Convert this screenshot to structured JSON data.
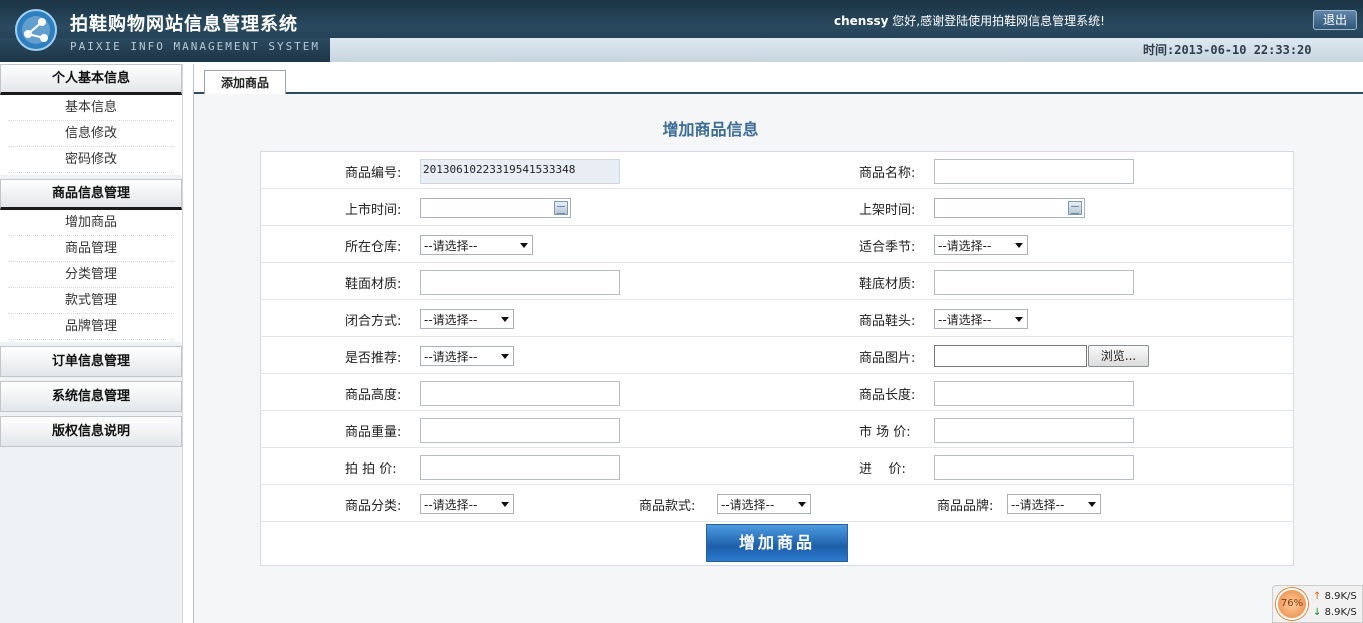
{
  "header": {
    "title": "拍鞋购物网站信息管理系统",
    "subtitle": "PAIXIE INFO MANAGEMENT SYSTEM",
    "welcome_user": "chenssy",
    "welcome_text": " 您好,感谢登陆使用拍鞋网信息管理系统!",
    "logout_label": "退出",
    "time_text": "时间:2013-06-10 22:33:20"
  },
  "sidebar": {
    "sections": [
      {
        "label": "个人基本信息",
        "items": [
          "基本信息",
          "信息修改",
          "密码修改"
        ]
      },
      {
        "label": "商品信息管理",
        "items": [
          "增加商品",
          "商品管理",
          "分类管理",
          "款式管理",
          "品牌管理"
        ]
      },
      {
        "label": "订单信息管理"
      },
      {
        "label": "系统信息管理"
      },
      {
        "label": "版权信息说明"
      }
    ]
  },
  "main": {
    "tab_label": "添加商品",
    "form_title": "增加商品信息",
    "submit_label": "增加商品",
    "fields": {
      "product_id_label": "商品编号:",
      "product_id_value": "20130610223319541533348",
      "product_name_label": "商品名称:",
      "release_time_label": "上市时间:",
      "shelf_time_label": "上架时间:",
      "warehouse_label": "所在仓库:",
      "warehouse_value": "--请选择--",
      "season_label": "适合季节:",
      "season_value": "--请选择--",
      "upper_material_label": "鞋面材质:",
      "sole_material_label": "鞋底材质:",
      "closure_label": "闭合方式:",
      "closure_value": "--请选择--",
      "toe_label": "商品鞋头:",
      "toe_value": "--请选择--",
      "recommend_label": "是否推荐:",
      "recommend_value": "--请选择--",
      "image_label": "商品图片:",
      "browse_label": "浏览...",
      "height_label": "商品高度:",
      "length_label": "商品长度:",
      "weight_label": "商品重量:",
      "market_price_label": "市 场 价:",
      "paixie_price_label": "拍 拍 价:",
      "purchase_price_label": "进    价:",
      "category_label": "商品分类:",
      "category_value": "--请选择--",
      "style_label": "商品款式:",
      "style_value": "--请选择--",
      "brand_label": "商品品牌:",
      "brand_value": "--请选择--"
    }
  },
  "net_widget": {
    "percent": "76%",
    "up": "8.9K/S",
    "down": "8.9K/S"
  },
  "colors": {
    "header_bg": "#1b3344",
    "accent_title": "#3d6d95",
    "submit_bg": "#1d5fa8"
  }
}
